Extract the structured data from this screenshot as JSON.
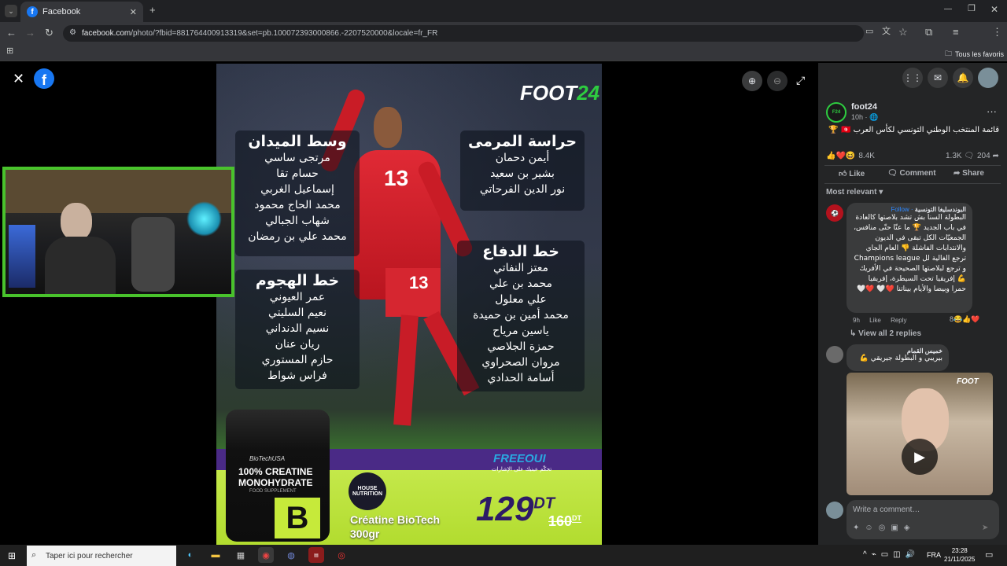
{
  "browser": {
    "tab_title": "Facebook",
    "url_domain": "facebook.com",
    "url_path": "/photo/?fbid=881764400913319&set=pb.100072393000866.-2207520000&locale=fr_FR",
    "bookmarks_label": "Tous les favoris"
  },
  "poster": {
    "brand": "FOOT",
    "brand_num": "24",
    "sections": [
      {
        "title": "حراسة المرمى",
        "names": [
          "أيمن دحمان",
          "بشير بن سعيد",
          "نور الدين الفرحاتي"
        ]
      },
      {
        "title": "وسط الميدان",
        "names": [
          "مرتجى ساسي",
          "حسام تقا",
          "إسماعيل الغربي",
          "محمد الحاج محمود",
          "شهاب الجبالي",
          "محمد علي بن رمضان"
        ]
      },
      {
        "title": "خط الدفاع",
        "names": [
          "معتز النفاتي",
          "محمد بن علي",
          "علي معلول",
          "محمد أمين بن حميدة",
          "ياسين مرياح",
          "حمزة الجلاصي",
          "مروان الصحراوي",
          "أسامة الحدادي"
        ]
      },
      {
        "title": "خط الهجوم",
        "names": [
          "عمر العيوني",
          "نعيم السليتي",
          "نسيم الدنداني",
          "ريان عنان",
          "حازم المستوري",
          "فراس شواط"
        ]
      }
    ],
    "jersey_number": "13",
    "ad": {
      "tub_brand": "BioTechUSA",
      "tub_line1": "100% CREATINE",
      "tub_line2": "MONOHYDRATE",
      "tub_sub": "FOOD SUPPLEMENT",
      "house": "HOUSE NUTRITION",
      "freeoui": "FREEOUI",
      "freeoui_sub": "تحكّم عينيك على الإشارات",
      "price": "129",
      "currency": "DT",
      "old_price": "160",
      "old_currency": "DT",
      "product": "Créatine BioTech",
      "weight": "300gr"
    }
  },
  "post": {
    "author": "foot24",
    "time": "10h · ",
    "caption": "قائمة المنتخب الوطني التونسي لكأس العرب 🇹🇳 🏆",
    "reactions": "8.4K",
    "comments_count": "1.3K",
    "shares_count": "204",
    "like_label": "Like",
    "comment_label": "Comment",
    "share_label": "Share",
    "sort_label": "Most relevant"
  },
  "comments": [
    {
      "author": "البوندسليغا التونسية",
      "follow": "· Follow",
      "text": "البطولة السنا بش تشد بلاصتها كالعادة في باب الجديد 🏆 ما عنّا حتّى منافس، الجمعيّات الكل تبقى في الديون والانتدابات الفاشلة 👎 العام الجاي ترجع الغالية لل Champions league و ترجع لبلاصتها الصحيحة في الأفريك 💪 إفريقيا تحت السيطرة، إفريقيا حمرا وبيضا والأيام بيناتنا ❤️🤍 ❤️🤍",
      "time": "9h",
      "like": "Like",
      "reply": "Reply",
      "count": "8",
      "view_replies": "View all 2 replies"
    },
    {
      "author": "خميس القمام",
      "text": "بيريبي و البطولة جيريقي 💪"
    }
  ],
  "video_watermark": "FOOT",
  "write_comment_placeholder": "Write a comment…",
  "taskbar": {
    "search_placeholder": "Taper ici pour rechercher",
    "lang": "FRA",
    "time": "23:28",
    "date": "21/11/2025"
  },
  "colors": {
    "facebook_blue": "#1877f2",
    "webcam_border": "#49c32c",
    "poster_green": "#b6e23b",
    "poster_purple": "#5a2a8a"
  }
}
